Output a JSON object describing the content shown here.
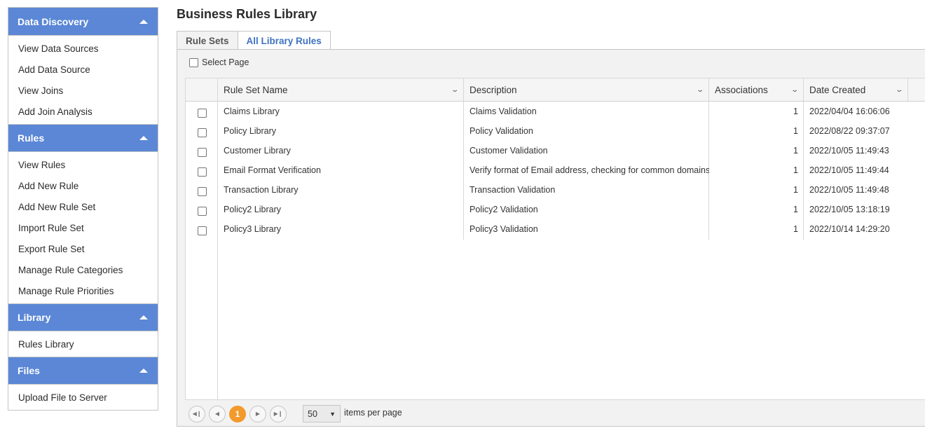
{
  "sidebar": {
    "groups": [
      {
        "title": "Data Discovery",
        "items": [
          "View Data Sources",
          "Add Data Source",
          "View Joins",
          "Add Join Analysis"
        ]
      },
      {
        "title": "Rules",
        "items": [
          "View Rules",
          "Add New Rule",
          "Add New Rule Set",
          "Import Rule Set",
          "Export Rule Set",
          "Manage Rule Categories",
          "Manage Rule Priorities"
        ]
      },
      {
        "title": "Library",
        "items": [
          "Rules Library"
        ]
      },
      {
        "title": "Files",
        "items": [
          "Upload File to Server"
        ]
      }
    ]
  },
  "page": {
    "title": "Business Rules Library"
  },
  "tabs": [
    "Rule Sets",
    "All Library Rules"
  ],
  "select_page_label": "Select Page",
  "grid": {
    "columns": [
      "Rule Set Name",
      "Description",
      "Associations",
      "Date Created"
    ],
    "rows": [
      [
        "Claims Library",
        "Claims Validation",
        "1",
        "2022/04/04 16:06:06"
      ],
      [
        "Policy Library",
        "Policy Validation",
        "1",
        "2022/08/22 09:37:07"
      ],
      [
        "Customer Library",
        "Customer Validation",
        "1",
        "2022/10/05 11:49:43"
      ],
      [
        "Email Format Verification",
        "Verify format of Email address, checking for common domains",
        "1",
        "2022/10/05 11:49:44"
      ],
      [
        "Transaction Library",
        "Transaction Validation",
        "1",
        "2022/10/05 11:49:48"
      ],
      [
        "Policy2 Library",
        "Policy2 Validation",
        "1",
        "2022/10/05 13:18:19"
      ],
      [
        "Policy3 Library",
        "Policy3 Validation",
        "1",
        "2022/10/14 14:29:20"
      ]
    ]
  },
  "pager": {
    "current_page": "1",
    "page_size": "50",
    "items_per_page_label": "items per page"
  },
  "colors": {
    "sidebar_header": "#5b87d6",
    "pager_current": "#f39a2c",
    "tab_link": "#3f72c2"
  }
}
